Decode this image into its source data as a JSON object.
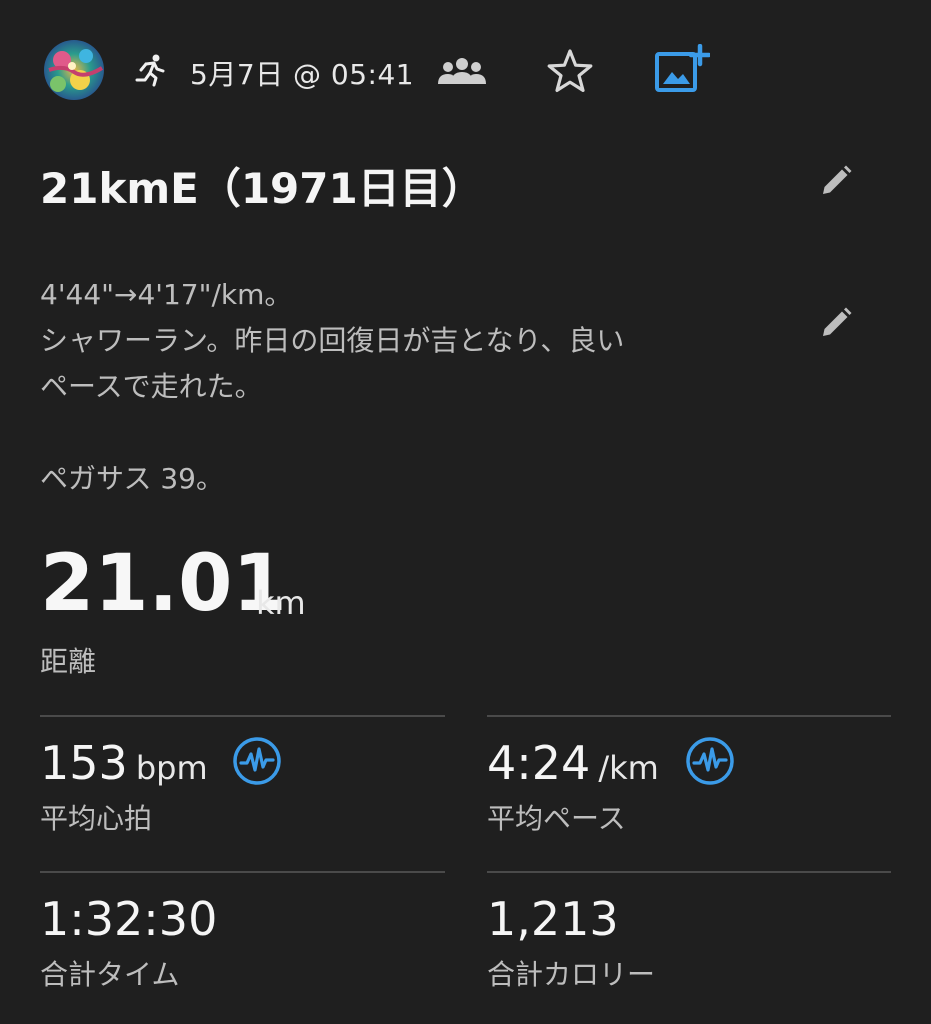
{
  "header": {
    "date": "5月7日 @ 05:41",
    "activity_type_icon": "running-icon",
    "audience_icon": "people-icon",
    "favorite_icon": "star-outline-icon",
    "add_photo_icon": "add-photo-icon"
  },
  "activity": {
    "title": "21kmE（1971日目）",
    "notes": [
      "4'44\"→4'17\"/km。",
      "シャワーラン。昨日の回復日が吉となり、良い",
      "ペースで走れた。",
      "",
      "ペガサス 39。"
    ]
  },
  "distance": {
    "value": "21.01",
    "unit": "km",
    "label": "距離"
  },
  "stats": {
    "avg_hr": {
      "value": "153",
      "unit": "bpm",
      "label": "平均心拍"
    },
    "avg_pace": {
      "value": "4:24",
      "unit": "/km",
      "label": "平均ペース"
    },
    "total_time": {
      "value": "1:32:30",
      "label": "合計タイム"
    },
    "calories": {
      "value": "1,213",
      "label": "合計カロリー"
    }
  },
  "colors": {
    "background": "#1f1f1f",
    "accent_blue": "#3b9be8",
    "text_primary": "#f5f5f5",
    "text_secondary": "#bdbdbd",
    "divider": "#4a4a4a"
  }
}
